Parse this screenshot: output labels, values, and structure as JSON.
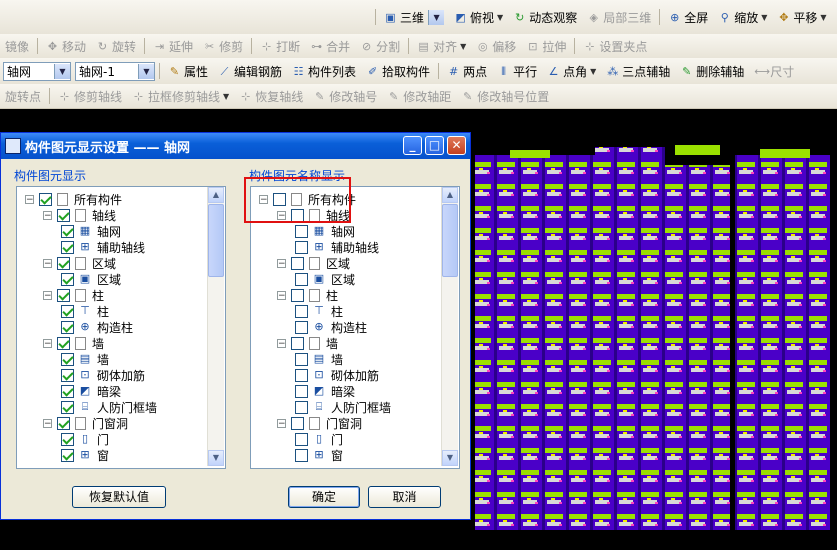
{
  "toolbar1": {
    "items": [
      {
        "icon": "cube-icon",
        "label": "三维",
        "dropdown": true
      },
      {
        "icon": "topview-icon",
        "label": "俯视",
        "dropdown": true
      },
      {
        "icon": "orbit-icon",
        "label": "动态观察"
      },
      {
        "icon": "local3d-icon",
        "label": "局部三维",
        "disabled": true
      },
      {
        "icon": "fullscreen-icon",
        "label": "全屏"
      },
      {
        "icon": "zoom-icon",
        "label": "缩放",
        "dropdown": true
      },
      {
        "icon": "pan-icon",
        "label": "平移",
        "dropdown": true
      }
    ]
  },
  "toolbar2": {
    "items": [
      "镜像",
      "移动",
      "旋转",
      "延伸",
      "修剪",
      "打断",
      "合并",
      "分割",
      "对齐",
      "偏移",
      "拉伸",
      "设置夹点"
    ]
  },
  "toolbar3": {
    "combo1": "轴网",
    "combo2": "轴网-1",
    "items": [
      "属性",
      "编辑钢筋",
      "构件列表",
      "拾取构件",
      "两点",
      "平行",
      "点角",
      "三点辅轴",
      "删除辅轴",
      "尺寸"
    ]
  },
  "toolbar4": {
    "items": [
      "旋转点",
      "修剪轴线",
      "拉框修剪轴线",
      "恢复轴线",
      "修改轴号",
      "修改轴距",
      "修改轴号位置"
    ]
  },
  "dialog": {
    "title": "构件图元显示设置 —— 轴网",
    "left_group_label": "构件图元显示",
    "right_group_label": "构件图元名称显示",
    "left_tree": [
      {
        "label": "所有构件",
        "level": 0,
        "checked": true,
        "icon": "page"
      },
      {
        "label": "轴线",
        "level": 1,
        "checked": true,
        "icon": "page"
      },
      {
        "label": "轴网",
        "level": 2,
        "checked": true,
        "icon": "grid-icon"
      },
      {
        "label": "辅助轴线",
        "level": 2,
        "checked": true,
        "icon": "aux-axis-icon"
      },
      {
        "label": "区域",
        "level": 1,
        "checked": true,
        "icon": "page"
      },
      {
        "label": "区域",
        "level": 2,
        "checked": true,
        "icon": "region-icon"
      },
      {
        "label": "柱",
        "level": 1,
        "checked": true,
        "icon": "page"
      },
      {
        "label": "柱",
        "level": 2,
        "checked": true,
        "icon": "column-icon"
      },
      {
        "label": "构造柱",
        "level": 2,
        "checked": true,
        "icon": "constructional-column-icon"
      },
      {
        "label": "墙",
        "level": 1,
        "checked": true,
        "icon": "page"
      },
      {
        "label": "墙",
        "level": 2,
        "checked": true,
        "icon": "wall-icon"
      },
      {
        "label": "砌体加筋",
        "level": 2,
        "checked": true,
        "icon": "masonry-rebar-icon"
      },
      {
        "label": "暗梁",
        "level": 2,
        "checked": true,
        "icon": "hidden-beam-icon"
      },
      {
        "label": "人防门框墙",
        "level": 2,
        "checked": true,
        "icon": "civil-defense-door-wall-icon"
      },
      {
        "label": "门窗洞",
        "level": 1,
        "checked": true,
        "icon": "page"
      },
      {
        "label": "门",
        "level": 2,
        "checked": true,
        "icon": "door-icon"
      },
      {
        "label": "窗",
        "level": 2,
        "checked": true,
        "icon": "window-icon"
      }
    ],
    "right_tree": [
      {
        "label": "所有构件",
        "level": 0,
        "checked": false,
        "icon": "page"
      },
      {
        "label": "轴线",
        "level": 1,
        "checked": false,
        "icon": "page"
      },
      {
        "label": "轴网",
        "level": 2,
        "checked": false,
        "icon": "grid-icon"
      },
      {
        "label": "辅助轴线",
        "level": 2,
        "checked": false,
        "icon": "aux-axis-icon"
      },
      {
        "label": "区域",
        "level": 1,
        "checked": false,
        "icon": "page"
      },
      {
        "label": "区域",
        "level": 2,
        "checked": false,
        "icon": "region-icon"
      },
      {
        "label": "柱",
        "level": 1,
        "checked": false,
        "icon": "page"
      },
      {
        "label": "柱",
        "level": 2,
        "checked": false,
        "icon": "column-icon"
      },
      {
        "label": "构造柱",
        "level": 2,
        "checked": false,
        "icon": "constructional-column-icon"
      },
      {
        "label": "墙",
        "level": 1,
        "checked": false,
        "icon": "page"
      },
      {
        "label": "墙",
        "level": 2,
        "checked": false,
        "icon": "wall-icon"
      },
      {
        "label": "砌体加筋",
        "level": 2,
        "checked": false,
        "icon": "masonry-rebar-icon"
      },
      {
        "label": "暗梁",
        "level": 2,
        "checked": false,
        "icon": "hidden-beam-icon"
      },
      {
        "label": "人防门框墙",
        "level": 2,
        "checked": false,
        "icon": "civil-defense-door-wall-icon"
      },
      {
        "label": "门窗洞",
        "level": 1,
        "checked": false,
        "icon": "page"
      },
      {
        "label": "门",
        "level": 2,
        "checked": false,
        "icon": "door-icon"
      },
      {
        "label": "窗",
        "level": 2,
        "checked": false,
        "icon": "window-icon"
      }
    ],
    "restore_label": "恢复默认值",
    "ok_label": "确定",
    "cancel_label": "取消"
  },
  "colors": {
    "building_purple": "#4a00c8",
    "building_green": "#9be000",
    "building_yellow": "#f0f000",
    "highlight_red": "#e01010"
  }
}
